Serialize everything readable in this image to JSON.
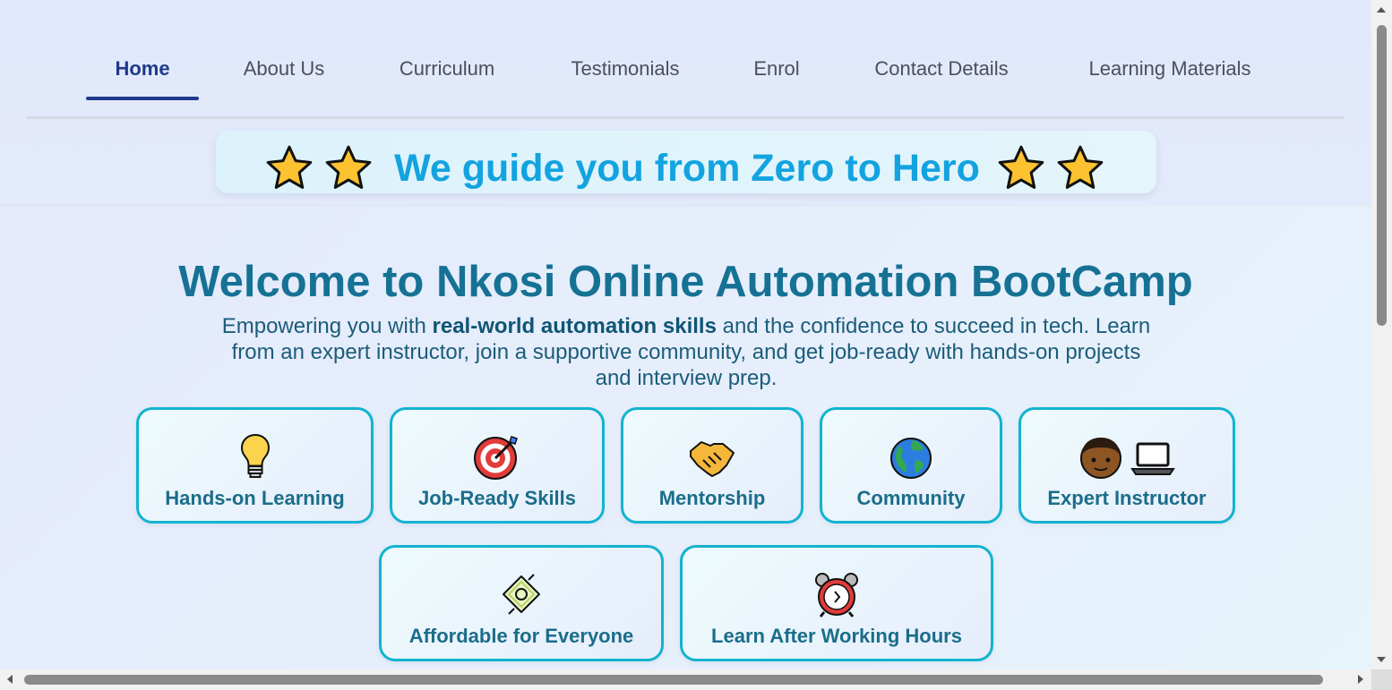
{
  "nav": {
    "items": [
      {
        "label": "Home",
        "active": true
      },
      {
        "label": "About Us"
      },
      {
        "label": "Curriculum"
      },
      {
        "label": "Testimonials"
      },
      {
        "label": "Enrol"
      },
      {
        "label": "Contact Details"
      },
      {
        "label": "Learning Materials"
      }
    ]
  },
  "tagline": {
    "text": "We guide you from Zero to Hero",
    "icons": [
      "star-icon",
      "star-icon",
      "star-icon",
      "star-icon"
    ]
  },
  "hero": {
    "title": "Welcome to Nkosi Online Automation BootCamp",
    "subtitle_pre": "Empowering you with ",
    "subtitle_bold": "real-world automation skills",
    "subtitle_post": " and the confidence to succeed in tech. Learn from an expert instructor, join a supportive community, and get job-ready with hands-on projects and interview prep."
  },
  "features": [
    {
      "label": "Hands-on Learning",
      "icon": "lightbulb-icon"
    },
    {
      "label": "Job-Ready Skills",
      "icon": "target-icon"
    },
    {
      "label": "Mentorship",
      "icon": "handshake-icon"
    },
    {
      "label": "Community",
      "icon": "globe-icon"
    },
    {
      "label": "Expert Instructor",
      "icon": "person-laptop-icon"
    },
    {
      "label": "Affordable for Everyone",
      "icon": "money-icon"
    },
    {
      "label": "Learn After Working Hours",
      "icon": "alarm-clock-icon"
    }
  ],
  "colors": {
    "accent": "#12a3e0",
    "title": "#167294",
    "card_border": "#12b3cf",
    "nav_active": "#1d3a8a"
  }
}
